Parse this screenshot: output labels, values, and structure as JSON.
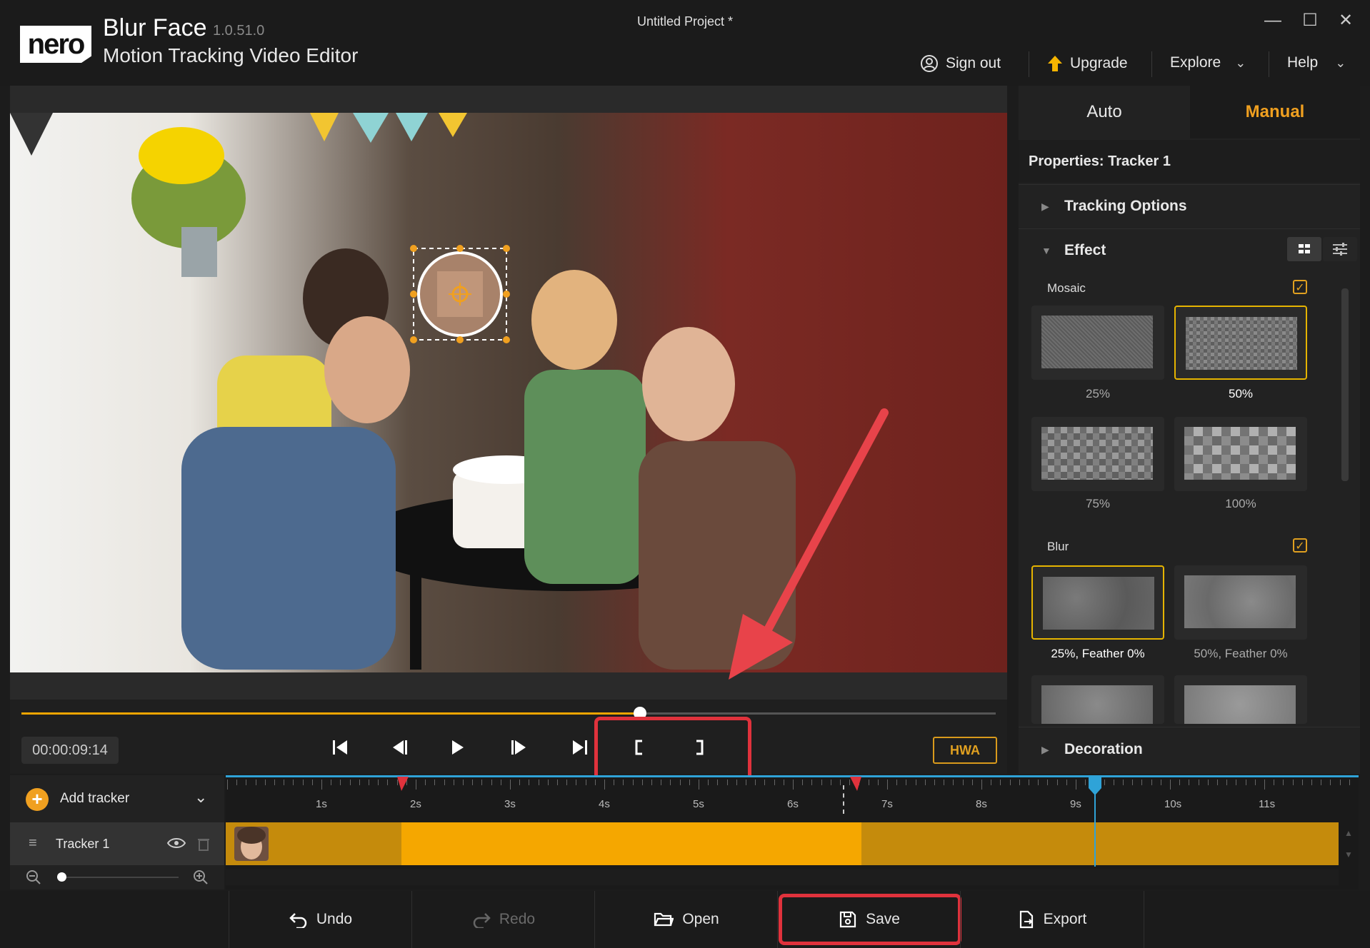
{
  "app": {
    "logo_text": "nero",
    "name": "Blur Face",
    "version": "1.0.51.0",
    "subtitle": "Motion Tracking Video Editor",
    "project_title": "Untitled Project *"
  },
  "window_controls": {
    "minimize": "—",
    "maximize": "☐",
    "close": "✕"
  },
  "top_nav": {
    "sign_out": "Sign out",
    "upgrade": "Upgrade",
    "explore": "Explore",
    "help": "Help"
  },
  "player": {
    "timecode": "00:00:09:14",
    "progress": 0.635,
    "hwa_label": "HWA"
  },
  "right_panel": {
    "tabs": {
      "auto": "Auto",
      "manual": "Manual"
    },
    "active_tab": "Manual",
    "properties_title": "Properties:  Tracker 1",
    "sections": {
      "tracking_options": "Tracking Options",
      "effect": "Effect",
      "decoration": "Decoration"
    },
    "mosaic": {
      "label": "Mosaic",
      "checked": true,
      "options": [
        "25%",
        "50%",
        "75%",
        "100%"
      ],
      "selected": "50%"
    },
    "blur": {
      "label": "Blur",
      "checked": true,
      "options": [
        "25%, Feather 0%",
        "50%, Feather 0%"
      ],
      "selected": "25%, Feather 0%"
    }
  },
  "timeline": {
    "add_tracker": "Add tracker",
    "tracker_name": "Tracker 1",
    "ruler_labels": [
      "1s",
      "2s",
      "3s",
      "4s",
      "5s",
      "6s",
      "7s",
      "8s",
      "9s",
      "10s",
      "11s"
    ]
  },
  "bottom_bar": {
    "undo": "Undo",
    "redo": "Redo",
    "open": "Open",
    "save": "Save",
    "export": "Export"
  },
  "colors": {
    "accent": "#f0a020",
    "highlight_box": "#e0323c",
    "annotation_arrow": "#e8434a",
    "playhead": "#2fa3d8"
  }
}
